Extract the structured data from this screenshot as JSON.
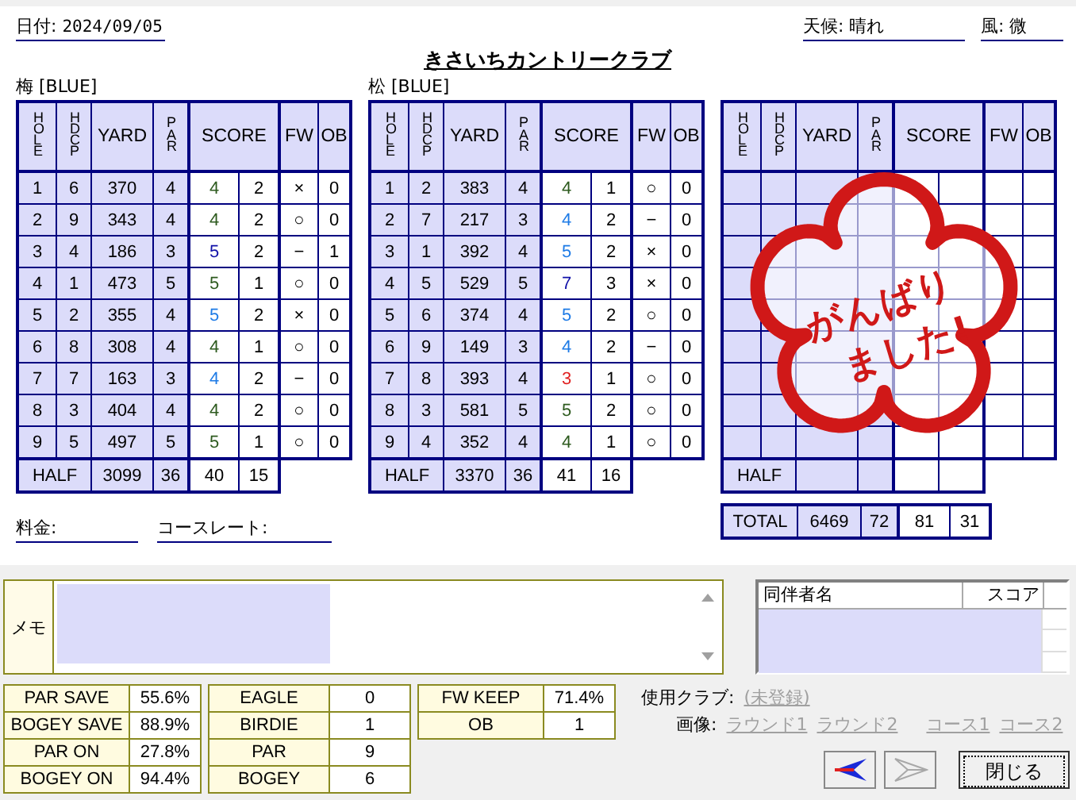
{
  "header": {
    "date_label": "日付:",
    "date": "2024/09/05",
    "course": "きさいちカントリークラブ",
    "weather_label": "天候:",
    "weather": "晴れ",
    "wind_label": "風:",
    "wind": "微"
  },
  "cards": [
    {
      "title": "梅 [BLUE]",
      "columns": [
        "HOLE",
        "HDCP",
        "YARD",
        "PAR",
        "SCORE",
        "FW",
        "OB"
      ],
      "holes": [
        {
          "hole": "1",
          "hdcp": "6",
          "yard": "370",
          "par": "4",
          "score": "4",
          "putts": "2",
          "fw": "×",
          "ob": "0",
          "color": "#2d5a1e"
        },
        {
          "hole": "2",
          "hdcp": "9",
          "yard": "343",
          "par": "4",
          "score": "4",
          "putts": "2",
          "fw": "○",
          "ob": "0",
          "color": "#2d5a1e"
        },
        {
          "hole": "3",
          "hdcp": "4",
          "yard": "186",
          "par": "3",
          "score": "5",
          "putts": "2",
          "fw": "−",
          "ob": "1",
          "color": "#1010a8"
        },
        {
          "hole": "4",
          "hdcp": "1",
          "yard": "473",
          "par": "5",
          "score": "5",
          "putts": "1",
          "fw": "○",
          "ob": "0",
          "color": "#2d5a1e"
        },
        {
          "hole": "5",
          "hdcp": "2",
          "yard": "355",
          "par": "4",
          "score": "5",
          "putts": "2",
          "fw": "×",
          "ob": "0",
          "color": "#1e7be6"
        },
        {
          "hole": "6",
          "hdcp": "8",
          "yard": "308",
          "par": "4",
          "score": "4",
          "putts": "1",
          "fw": "○",
          "ob": "0",
          "color": "#2d5a1e"
        },
        {
          "hole": "7",
          "hdcp": "7",
          "yard": "163",
          "par": "3",
          "score": "4",
          "putts": "2",
          "fw": "−",
          "ob": "0",
          "color": "#1e7be6"
        },
        {
          "hole": "8",
          "hdcp": "3",
          "yard": "404",
          "par": "4",
          "score": "4",
          "putts": "2",
          "fw": "○",
          "ob": "0",
          "color": "#2d5a1e"
        },
        {
          "hole": "9",
          "hdcp": "5",
          "yard": "497",
          "par": "5",
          "score": "5",
          "putts": "1",
          "fw": "○",
          "ob": "0",
          "color": "#2d5a1e"
        }
      ],
      "half": {
        "label": "HALF",
        "yard": "3099",
        "par": "36",
        "score": "40",
        "putts": "15"
      }
    },
    {
      "title": "松 [BLUE]",
      "columns": [
        "HOLE",
        "HDCP",
        "YARD",
        "PAR",
        "SCORE",
        "FW",
        "OB"
      ],
      "holes": [
        {
          "hole": "1",
          "hdcp": "2",
          "yard": "383",
          "par": "4",
          "score": "4",
          "putts": "1",
          "fw": "○",
          "ob": "0",
          "color": "#2d5a1e"
        },
        {
          "hole": "2",
          "hdcp": "7",
          "yard": "217",
          "par": "3",
          "score": "4",
          "putts": "2",
          "fw": "−",
          "ob": "0",
          "color": "#1e7be6"
        },
        {
          "hole": "3",
          "hdcp": "1",
          "yard": "392",
          "par": "4",
          "score": "5",
          "putts": "2",
          "fw": "×",
          "ob": "0",
          "color": "#1e7be6"
        },
        {
          "hole": "4",
          "hdcp": "5",
          "yard": "529",
          "par": "5",
          "score": "7",
          "putts": "3",
          "fw": "×",
          "ob": "0",
          "color": "#1010a8"
        },
        {
          "hole": "5",
          "hdcp": "6",
          "yard": "374",
          "par": "4",
          "score": "5",
          "putts": "2",
          "fw": "○",
          "ob": "0",
          "color": "#1e7be6"
        },
        {
          "hole": "6",
          "hdcp": "9",
          "yard": "149",
          "par": "3",
          "score": "4",
          "putts": "2",
          "fw": "−",
          "ob": "0",
          "color": "#1e7be6"
        },
        {
          "hole": "7",
          "hdcp": "8",
          "yard": "393",
          "par": "4",
          "score": "3",
          "putts": "1",
          "fw": "○",
          "ob": "0",
          "color": "#e02020"
        },
        {
          "hole": "8",
          "hdcp": "3",
          "yard": "581",
          "par": "5",
          "score": "5",
          "putts": "2",
          "fw": "○",
          "ob": "0",
          "color": "#2d5a1e"
        },
        {
          "hole": "9",
          "hdcp": "4",
          "yard": "352",
          "par": "4",
          "score": "4",
          "putts": "1",
          "fw": "○",
          "ob": "0",
          "color": "#2d5a1e"
        }
      ],
      "half": {
        "label": "HALF",
        "yard": "3370",
        "par": "36",
        "score": "41",
        "putts": "16"
      }
    },
    {
      "columns": [
        "HOLE",
        "HDCP",
        "YARD",
        "PAR",
        "SCORE",
        "FW",
        "OB"
      ],
      "half": {
        "label": "HALF"
      },
      "total": {
        "label": "TOTAL",
        "yard": "6469",
        "par": "72",
        "score": "81",
        "putts": "31"
      },
      "stamp": {
        "lines": [
          "がんばり",
          "ました!"
        ]
      }
    }
  ],
  "fee_label": "料金:",
  "rating_label": "コースレート:",
  "memo": {
    "label": "メモ"
  },
  "companions": {
    "columns": [
      "同伴者名",
      "スコア"
    ]
  },
  "stats": [
    [
      {
        "label": "PAR SAVE",
        "value": "55.6%"
      },
      {
        "label": "BOGEY SAVE",
        "value": "88.9%"
      },
      {
        "label": "PAR ON",
        "value": "27.8%"
      },
      {
        "label": "BOGEY ON",
        "value": "94.4%"
      }
    ],
    [
      {
        "label": "EAGLE",
        "value": "0"
      },
      {
        "label": "BIRDIE",
        "value": "1"
      },
      {
        "label": "PAR",
        "value": "9"
      },
      {
        "label": "BOGEY",
        "value": "6"
      }
    ],
    [
      {
        "label": "FW KEEP",
        "value": "71.4%"
      },
      {
        "label": "OB",
        "value": "1"
      }
    ]
  ],
  "clubs": {
    "label": "使用クラブ:",
    "link": "(未登録)"
  },
  "images": {
    "label": "画像:",
    "links": [
      "ラウンド1",
      "ラウンド2",
      "コース1",
      "コース2"
    ]
  },
  "nav": [
    {
      "kind": "back",
      "disabled": false
    },
    {
      "kind": "forward",
      "disabled": true
    }
  ],
  "close_button": "閉じる"
}
